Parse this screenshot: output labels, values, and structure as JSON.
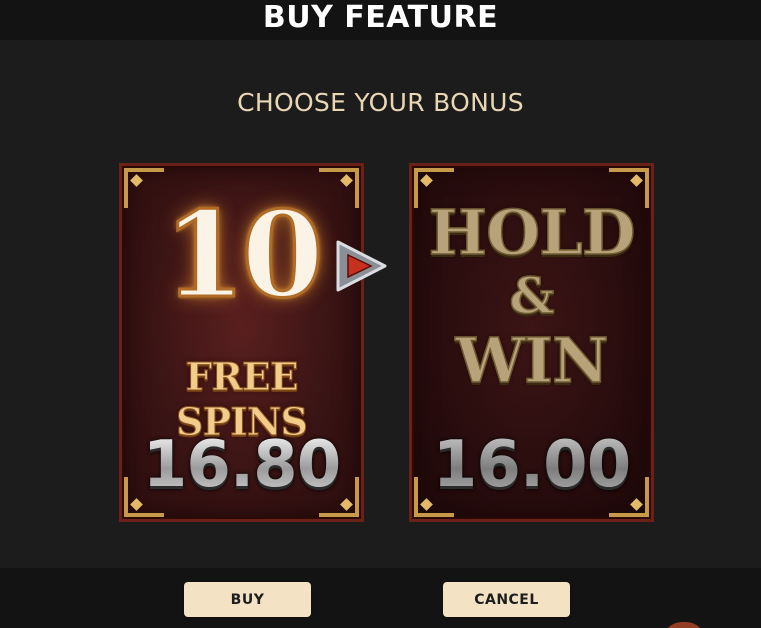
{
  "header": {
    "title": "BUY FEATURE"
  },
  "subtitle": "CHOOSE YOUR BONUS",
  "cards": {
    "free_spins": {
      "count": "10",
      "label": "FREE SPINS",
      "price": "16.80",
      "selected": true
    },
    "hold_and_win": {
      "line1": "HOLD",
      "line2": "&",
      "line3": "WIN",
      "price": "16.00",
      "selected": false
    }
  },
  "buttons": {
    "buy": "BUY",
    "cancel": "CANCEL"
  },
  "icons": {
    "selection_arrow": "play-arrow-icon"
  },
  "colors": {
    "background": "#1c1c1c",
    "header_bar": "#131313",
    "subtitle_text": "#e9d7b4",
    "button_bg": "#f4e2c4",
    "card_border": "#6b2118",
    "gold_accent": "#c79a4a",
    "arrow_red": "#c8301f"
  }
}
